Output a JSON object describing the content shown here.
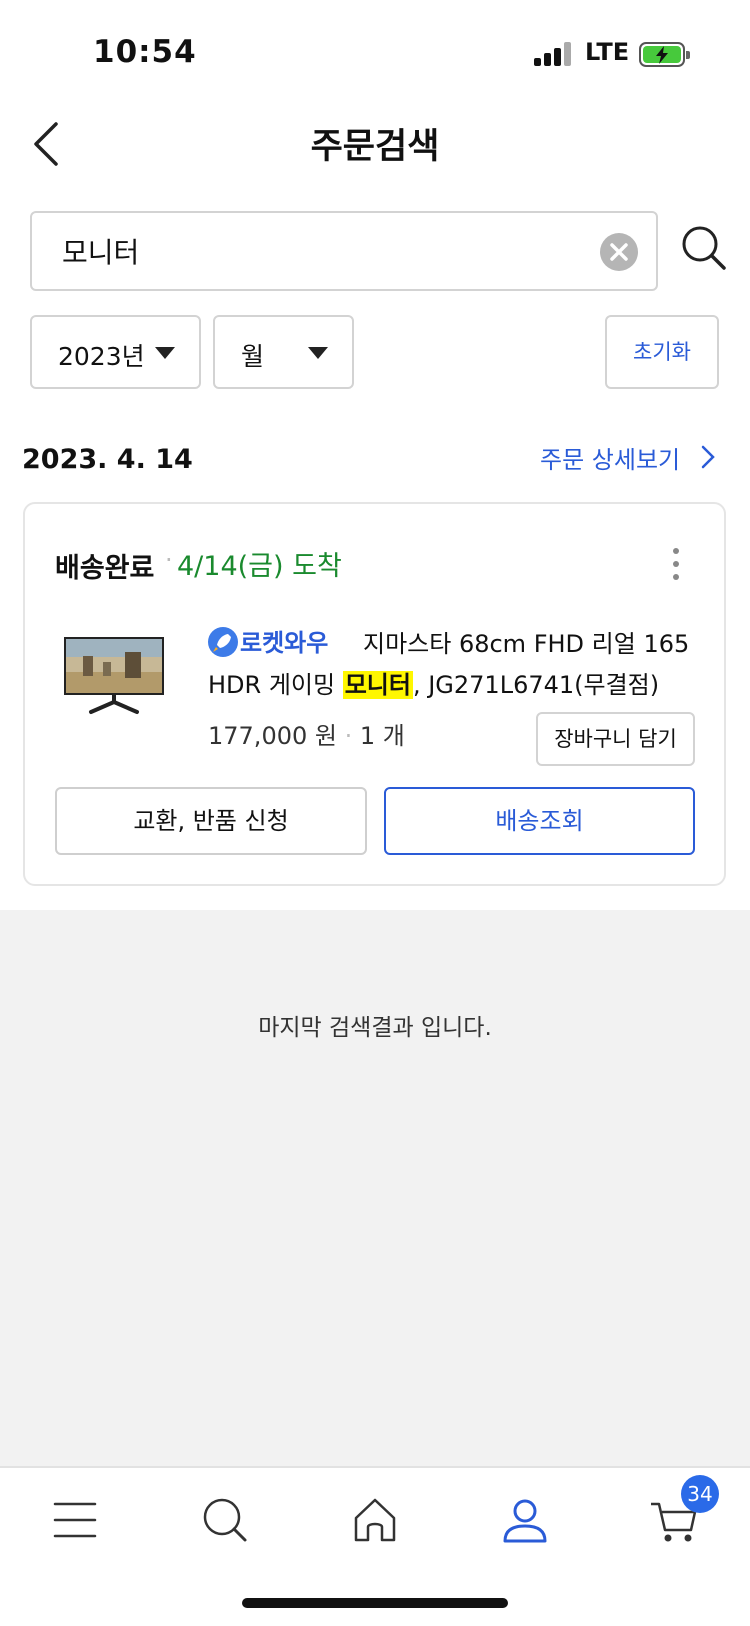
{
  "status_bar": {
    "time": "10:54",
    "network": "LTE"
  },
  "header": {
    "title": "주문검색"
  },
  "search": {
    "value": "모니터"
  },
  "filters": {
    "year": "2023년",
    "month": "월",
    "reset_label": "초기화"
  },
  "order": {
    "date": "2023. 4. 14",
    "detail_link": "주문 상세보기",
    "status": "배송완료",
    "separator": "·",
    "arrival": "4/14(금) 도착",
    "delivery_badge": "로켓와우",
    "product_name_part1": "지마스타 68cm FHD 리얼 165",
    "product_name_part2_prefix": "HDR 게이밍 ",
    "product_name_highlight": "모니터",
    "product_name_part2_suffix": ", JG271L6741(무결점)",
    "price": "177,000 원",
    "quantity": "1 개",
    "add_to_cart_label": "장바구니 담기",
    "return_button": "교환, 반품 신청",
    "track_button": "배송조회"
  },
  "end_message": "마지막 검색결과 입니다.",
  "tab_bar": {
    "items": [
      "menu-icon",
      "search-icon",
      "home-icon",
      "my-account-icon",
      "cart-icon"
    ],
    "active": "my-account-icon",
    "cart_badge": "34"
  },
  "colors": {
    "accent": "#2a5bd7",
    "arrival_green": "#1a8a2e",
    "highlight": "#fff700",
    "badge": "#2a6ae8"
  }
}
